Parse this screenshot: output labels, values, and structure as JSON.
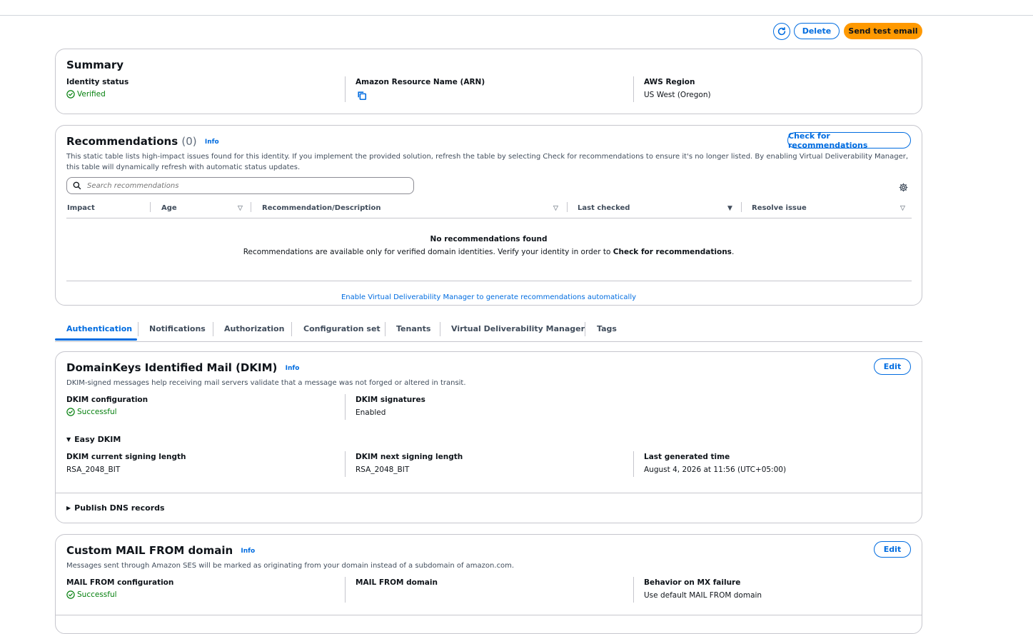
{
  "header": {
    "refresh_icon": "refresh-icon",
    "delete_label": "Delete",
    "send_test_email_label": "Send test email"
  },
  "summary": {
    "title": "Summary",
    "identity_status_label": "Identity status",
    "identity_status_value": "Verified",
    "arn_label": "Amazon Resource Name (ARN)",
    "copy_icon": "copy-icon",
    "region_label": "AWS Region",
    "region_value": "US West (Oregon)"
  },
  "recommendations": {
    "title": "Recommendations",
    "count": "(0)",
    "info": "Info",
    "check_button": "Check for recommendations",
    "description": "This static table lists high-impact issues found for this identity. If you implement the provided solution, refresh the table by selecting Check for recommendations to ensure it's no longer listed. By enabling Virtual Deliverability Manager, this table will dynamically refresh with automatic status updates.",
    "search_placeholder": "Search recommendations",
    "settings_icon": "gear-icon",
    "columns": [
      "Impact",
      "Age",
      "Recommendation/Description",
      "Last checked",
      "Resolve issue"
    ],
    "empty_title": "No recommendations found",
    "empty_text_prefix": "Recommendations are available only for verified domain identities. Verify your identity in order to ",
    "empty_text_bold": "Check for recommendations",
    "empty_text_suffix": ".",
    "footer_link": "Enable Virtual Deliverability Manager to generate recommendations automatically"
  },
  "tabs": [
    {
      "label": "Authentication",
      "active": true
    },
    {
      "label": "Notifications",
      "active": false
    },
    {
      "label": "Authorization",
      "active": false
    },
    {
      "label": "Configuration set",
      "active": false
    },
    {
      "label": "Tenants",
      "active": false
    },
    {
      "label": "Virtual Deliverability Manager",
      "active": false
    },
    {
      "label": "Tags",
      "active": false
    }
  ],
  "dkim": {
    "title": "DomainKeys Identified Mail (DKIM)",
    "info": "Info",
    "edit_label": "Edit",
    "description": "DKIM-signed messages help receiving mail servers validate that a message was not forged or altered in transit.",
    "config_label": "DKIM configuration",
    "config_value": "Successful",
    "signatures_label": "DKIM signatures",
    "signatures_value": "Enabled",
    "easy_dkim_label": "Easy DKIM",
    "current_length_label": "DKIM current signing length",
    "current_length_value": "RSA_2048_BIT",
    "next_length_label": "DKIM next signing length",
    "next_length_value": "RSA_2048_BIT",
    "last_generated_label": "Last generated time",
    "last_generated_value": "August 4, 2026 at 11:56 (UTC+05:00)",
    "publish_dns_label": "Publish DNS records"
  },
  "mail_from": {
    "title": "Custom MAIL FROM domain",
    "info": "Info",
    "edit_label": "Edit",
    "description": "Messages sent through Amazon SES will be marked as originating from your domain instead of a subdomain of amazon.com.",
    "config_label": "MAIL FROM configuration",
    "config_value": "Successful",
    "domain_label": "MAIL FROM domain",
    "behavior_label": "Behavior on MX failure",
    "behavior_value": "Use default MAIL FROM domain"
  },
  "colors": {
    "accent": "#006ce0",
    "primary_button": "#ff9900",
    "success": "#037f0c",
    "border": "#c6c6cd"
  }
}
